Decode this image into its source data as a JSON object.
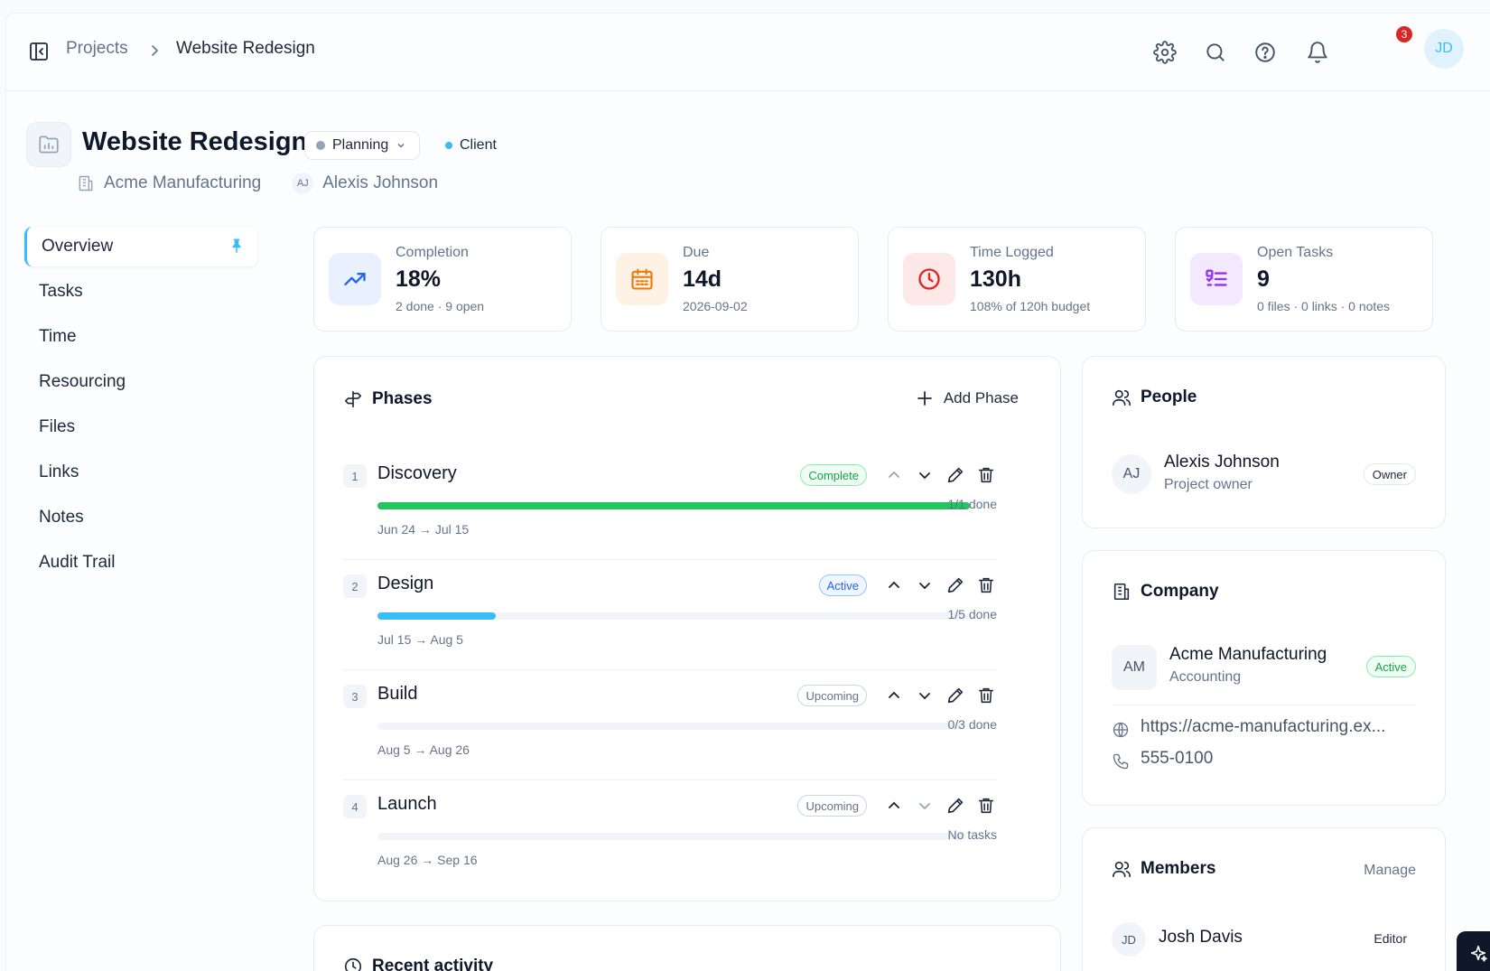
{
  "breadcrumb": {
    "root": "Projects",
    "current": "Website Redesign"
  },
  "notifications": {
    "count": "3"
  },
  "user": {
    "initials": "JD"
  },
  "project": {
    "title": "Website Redesign",
    "status": "Planning",
    "type": "Client",
    "company": "Acme Manufacturing",
    "owner_initials": "AJ",
    "owner": "Alexis Johnson"
  },
  "nav": {
    "items": [
      {
        "label": "Overview"
      },
      {
        "label": "Tasks"
      },
      {
        "label": "Time"
      },
      {
        "label": "Resourcing"
      },
      {
        "label": "Files"
      },
      {
        "label": "Links"
      },
      {
        "label": "Notes"
      },
      {
        "label": "Audit Trail"
      }
    ]
  },
  "stats": [
    {
      "label": "Completion",
      "value": "18%",
      "sub": "2 done · 9 open",
      "icon": "trend-up-icon",
      "color": "#2563eb",
      "bg": "#e8f1fd"
    },
    {
      "label": "Due",
      "value": "14d",
      "sub": "2026-09-02",
      "icon": "calendar-icon",
      "color": "#ea7a0c",
      "bg": "#fdf2e4"
    },
    {
      "label": "Time Logged",
      "value": "130h",
      "sub": "108% of 120h budget",
      "icon": "clock-icon",
      "color": "#dc2626",
      "bg": "#fde8e8"
    },
    {
      "label": "Open Tasks",
      "value": "9",
      "sub": "0 files · 0 links · 0 notes",
      "icon": "checklist-icon",
      "color": "#9333ea",
      "bg": "#f3e8fd"
    }
  ],
  "phases": {
    "title": "Phases",
    "add_label": "Add Phase",
    "items": [
      {
        "num": "1",
        "name": "Discovery",
        "status": "Complete",
        "progress_text": "1/1 done",
        "dates": "Jun 24 → Jul 15",
        "progress": 1.0,
        "bar_color": "#22c55e",
        "badge_color": "#16a34a",
        "badge_border": "#86efac"
      },
      {
        "num": "2",
        "name": "Design",
        "status": "Active",
        "progress_text": "1/5 done",
        "dates": "Jul 15 → Aug 5",
        "progress": 0.2,
        "bar_color": "#38bdf8",
        "badge_color": "#2563eb",
        "badge_border": "#93c5fd"
      },
      {
        "num": "3",
        "name": "Build",
        "status": "Upcoming",
        "progress_text": "0/3 done",
        "dates": "Aug 5 → Aug 26",
        "progress": 0.0,
        "bar_color": "#38bdf8",
        "badge_color": "#64748b",
        "badge_border": "#cbd5e1"
      },
      {
        "num": "4",
        "name": "Launch",
        "status": "Upcoming",
        "progress_text": "No tasks",
        "dates": "Aug 26 → Sep 16",
        "progress": 0.0,
        "bar_color": "#38bdf8",
        "badge_color": "#64748b",
        "badge_border": "#cbd5e1"
      }
    ]
  },
  "activity": {
    "title": "Recent activity"
  },
  "people": {
    "title": "People",
    "person": {
      "initials": "AJ",
      "name": "Alexis Johnson",
      "role": "Project owner",
      "tag": "Owner"
    }
  },
  "company": {
    "title": "Company",
    "initials": "AM",
    "name": "Acme Manufacturing",
    "industry": "Accounting",
    "status": "Active",
    "url": "https://acme-manufacturing.ex...",
    "phone": "555-0100"
  },
  "members": {
    "title": "Members",
    "manage_label": "Manage",
    "items": [
      {
        "initials": "JD",
        "name": "Josh Davis",
        "role": "Editor"
      }
    ]
  },
  "colors": {
    "accent": "#38bdf8",
    "text": "#0f172a",
    "muted": "#64748b"
  }
}
